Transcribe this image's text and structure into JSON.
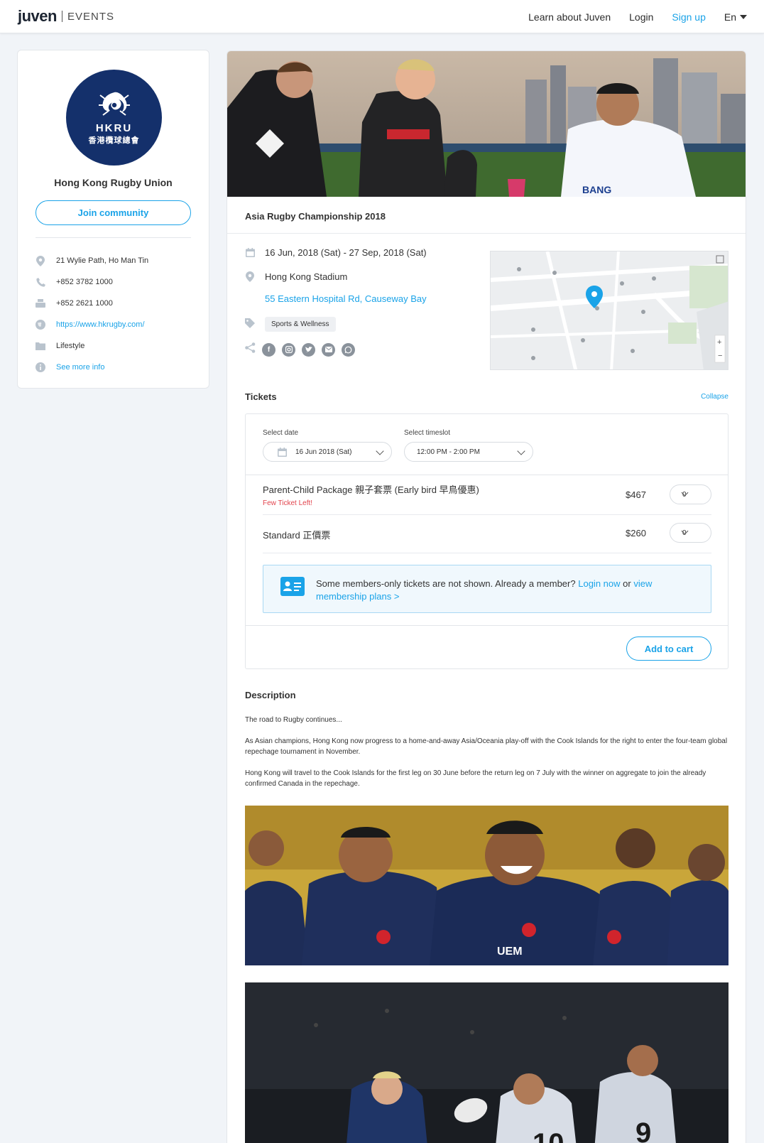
{
  "header": {
    "logo_word": "juven",
    "logo_events": "EVENTS",
    "nav": {
      "learn": "Learn about Juven",
      "login": "Login",
      "signup": "Sign up",
      "lang": "En"
    }
  },
  "org": {
    "logo_text": "HKRU",
    "logo_sub": "香港欖球總會",
    "name": "Hong Kong Rugby Union",
    "join_label": "Join community",
    "info": {
      "address": "21 Wylie Path, Ho Man Tin",
      "phone": "+852 3782 1000",
      "fax": "+852 2621 1000",
      "website": "https://www.hkrugby.com/",
      "category": "Lifestyle",
      "more": "See more info"
    }
  },
  "event": {
    "title": "Asia Rugby Championship 2018",
    "dates": "16 Jun, 2018 (Sat) - 27 Sep, 2018 (Sat)",
    "venue": "Hong Kong Stadium",
    "address": "55 Eastern Hospital Rd, Causeway Bay",
    "tag": "Sports & Wellness"
  },
  "tickets": {
    "title": "Tickets",
    "collapse": "Collapse",
    "date_label": "Select date",
    "date_value": "16 Jun 2018 (Sat)",
    "timeslot_label": "Select timeslot",
    "timeslot_value": "12:00 PM - 2:00 PM",
    "items": [
      {
        "name": "Parent-Child Package 親子套票 (Early bird 早鳥優惠)",
        "warning": "Few Ticket Left!",
        "price": "$467",
        "qty": "0"
      },
      {
        "name": "Standard 正價票",
        "price": "$260",
        "qty": "0"
      }
    ],
    "notice": {
      "text": "Some members-only tickets are not shown. Already a member?",
      "login": "Login now",
      "or": "or",
      "plans": "view membership plans >"
    },
    "add_to_cart": "Add to cart"
  },
  "description": {
    "title": "Description",
    "paragraphs": [
      "The road to Rugby continues...",
      "As Asian champions, Hong Kong now progress to a home-and-away Asia/Oceania play-off with the Cook Islands for the right to enter the four-team global repechage tournament in November.",
      "Hong Kong will travel to the Cook Islands for the first leg on 30 June before the return leg on 7 July with the winner on aggregate to join the already confirmed Canada in the repechage."
    ]
  },
  "colors": {
    "accent": "#1aa3e8",
    "warning": "#e2444d",
    "org_navy": "#14306b",
    "background": "#f1f4f8"
  }
}
